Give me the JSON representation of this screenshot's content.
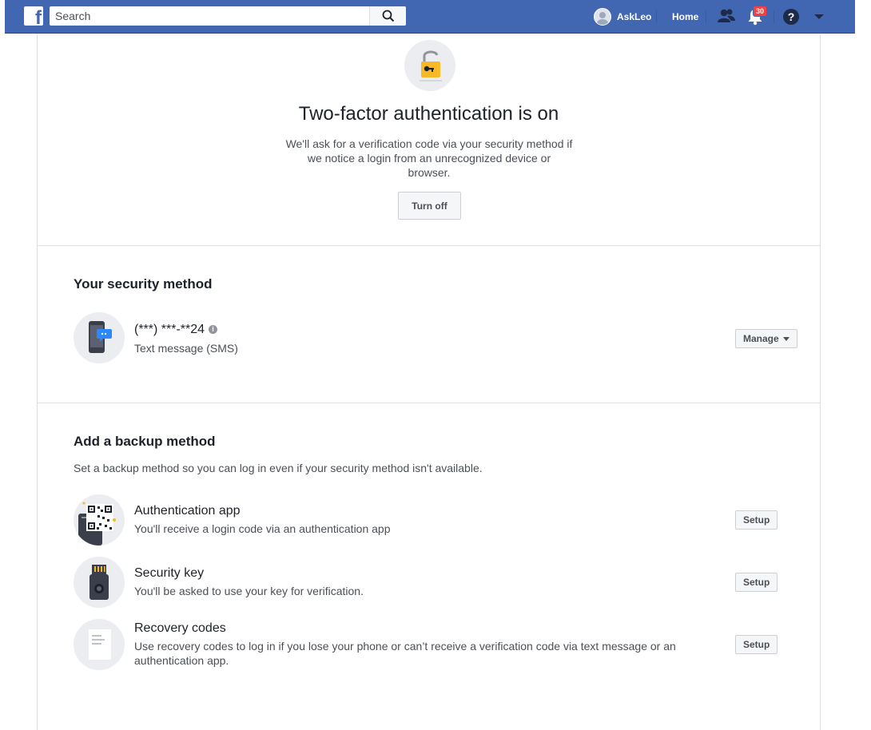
{
  "topbar": {
    "search_placeholder": "Search",
    "user_name": "AskLeo",
    "home_label": "Home",
    "notification_count": "30"
  },
  "status": {
    "title": "Two-factor authentication is on",
    "description": "We'll ask for a verification code via your security method if we notice a login from an unrecognized device or browser.",
    "turn_off_label": "Turn off"
  },
  "security_method": {
    "heading": "Your security method",
    "phone": "(***) ***-**24",
    "type": "Text message (SMS)",
    "manage_label": "Manage"
  },
  "backup": {
    "heading": "Add a backup method",
    "description": "Set a backup method so you can log in even if your security method isn't available.",
    "methods": [
      {
        "title": "Authentication app",
        "desc": "You'll receive a login code via an authentication app",
        "action": "Setup"
      },
      {
        "title": "Security key",
        "desc": "You'll be asked to use your key for verification.",
        "action": "Setup"
      },
      {
        "title": "Recovery codes",
        "desc": "Use recovery codes to log in if you lose your phone or can’t receive a verification code via text message or an authentication app.",
        "action": "Setup"
      }
    ]
  },
  "colors": {
    "brand": "#4267b2",
    "badge": "#fa3e3e",
    "lock": "#f7b928"
  }
}
